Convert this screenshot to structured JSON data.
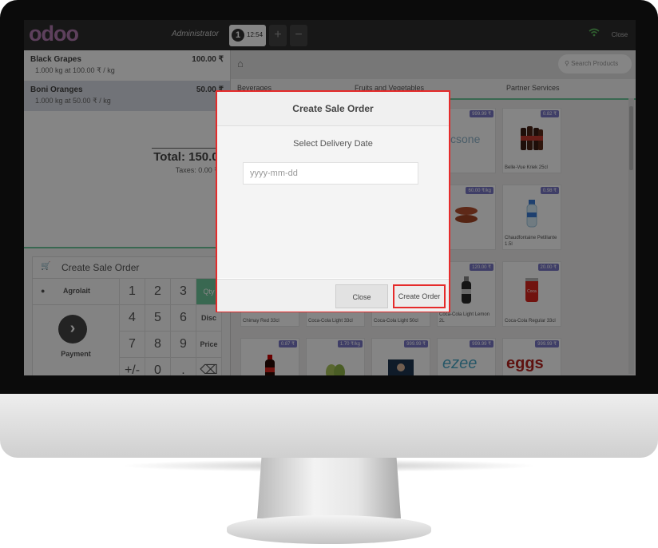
{
  "topbar": {
    "logo": "odoo",
    "user": "Administrator",
    "order_number": "1",
    "order_time": "12:54",
    "add_label": "+",
    "remove_label": "−",
    "wifi_icon": "wifi-icon",
    "close_label": "Close"
  },
  "orderlines": [
    {
      "name": "Black Grapes",
      "price": "100.00 ₹",
      "detail": "1.000 kg at 100.00 ₹ / kg"
    },
    {
      "name": "Boni Oranges",
      "price": "50.00 ₹",
      "detail": "1.000 kg at 50.00 ₹ / kg"
    }
  ],
  "summary": {
    "total": "Total: 150.00",
    "taxes": "Taxes: 0.00 ₹"
  },
  "actions": {
    "create_sale_order": "Create Sale Order",
    "customer": "Agrolait",
    "payment": "Payment",
    "payment_arrow": "›"
  },
  "numpad": {
    "keys": [
      "1",
      "2",
      "3",
      "4",
      "5",
      "6",
      "7",
      "8",
      "9",
      "+/-",
      "0",
      "."
    ],
    "qty": "Qty",
    "disc": "Disc",
    "price": "Price",
    "backspace": "⌫"
  },
  "products_header": {
    "search_placeholder": "Search Products",
    "categories": [
      "Beverages",
      "Fruits and Vegetables",
      "Partner Services"
    ]
  },
  "products": [
    {
      "name": "",
      "tag": "999.99 ₹"
    },
    {
      "name": "Belle-Vue Kriek 25cl",
      "tag": "0.82 ₹"
    },
    {
      "name": "Chaudfontaine Petillante 1.5l",
      "tag": "0.98 ₹"
    },
    {
      "name": "",
      "tag": "60.00 ₹/kg"
    },
    {
      "name": "Chimay Red 33cl",
      "tag": ""
    },
    {
      "name": "Coca-Cola Light 33cl",
      "tag": ""
    },
    {
      "name": "Coca-Cola Light 50cl",
      "tag": ""
    },
    {
      "name": "Coca-Cola Light Lemon 2L",
      "tag": "120.00 ₹"
    },
    {
      "name": "Coca-Cola Regular 33cl",
      "tag": "20.00 ₹"
    },
    {
      "name": "",
      "tag": "0.87 ₹"
    },
    {
      "name": "",
      "tag": "1.70 ₹/kg"
    },
    {
      "name": "",
      "tag": "999.99 ₹"
    },
    {
      "name": "",
      "tag": "999.99 ₹"
    },
    {
      "name": "",
      "tag": "999.99 ₹"
    }
  ],
  "modal": {
    "title": "Create Sale Order",
    "label": "Select Delivery Date",
    "date_placeholder": "yyyy-mm-dd",
    "close_label": "Close",
    "create_label": "Create Order"
  },
  "colors": {
    "accent": "#6ec89b",
    "highlight": "#e52b2b",
    "logo": "#b37bb0",
    "price_tag": "#7a77c6"
  }
}
